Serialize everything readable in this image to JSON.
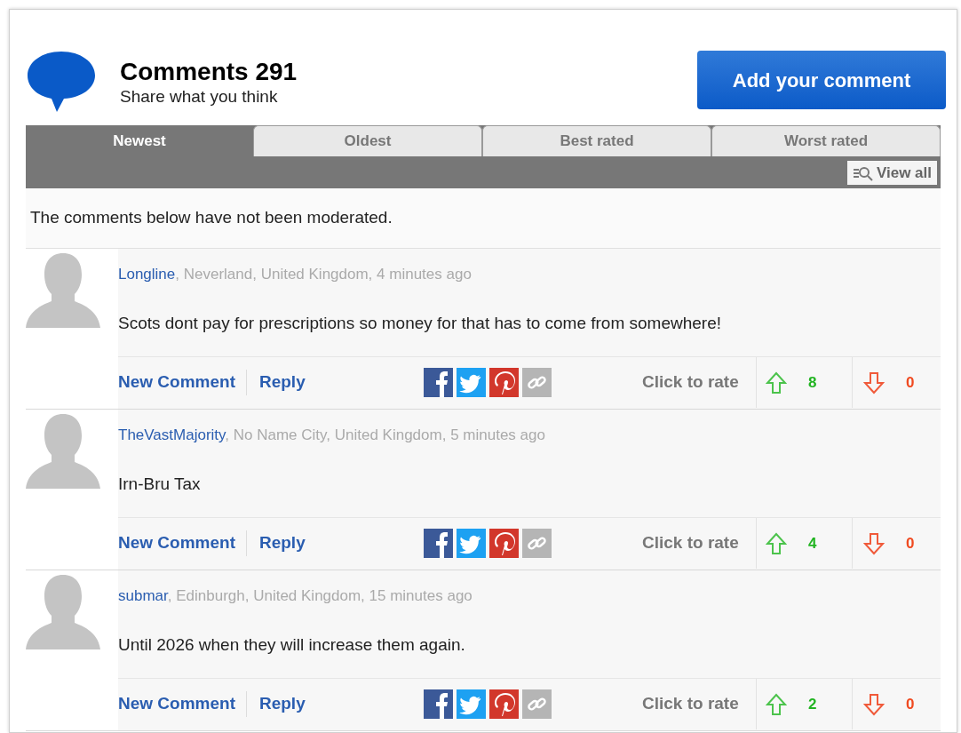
{
  "header": {
    "title": "Comments 291",
    "subtitle": "Share what you think",
    "add_button": "Add your comment"
  },
  "tabs": [
    {
      "label": "Newest",
      "selected": true
    },
    {
      "label": "Oldest",
      "selected": false
    },
    {
      "label": "Best rated",
      "selected": false
    },
    {
      "label": "Worst rated",
      "selected": false
    }
  ],
  "view_all": "View all",
  "notice": "The comments below have not been moderated.",
  "comments": [
    {
      "author": "Longline",
      "meta": ", Neverland, United Kingdom, 4 minutes ago",
      "body": "Scots dont pay for prescriptions so money for that has to come from somewhere!",
      "actions": [
        "New Comment",
        "Reply"
      ],
      "rate_label": "Click to rate",
      "up_count": "8",
      "down_count": "0"
    },
    {
      "author": "TheVastMajority",
      "meta": ", No Name City, United Kingdom, 5 minutes ago",
      "body": "Irn-Bru Tax",
      "actions": [
        "New Comment",
        "Reply"
      ],
      "rate_label": "Click to rate",
      "up_count": "4",
      "down_count": "0"
    },
    {
      "author": "submar",
      "meta": ", Edinburgh, United Kingdom, 15 minutes ago",
      "body": "Until 2026 when they will increase them again.",
      "actions": [
        "New Comment",
        "Reply"
      ],
      "rate_label": "Click to rate",
      "up_count": "2",
      "down_count": "0"
    }
  ]
}
